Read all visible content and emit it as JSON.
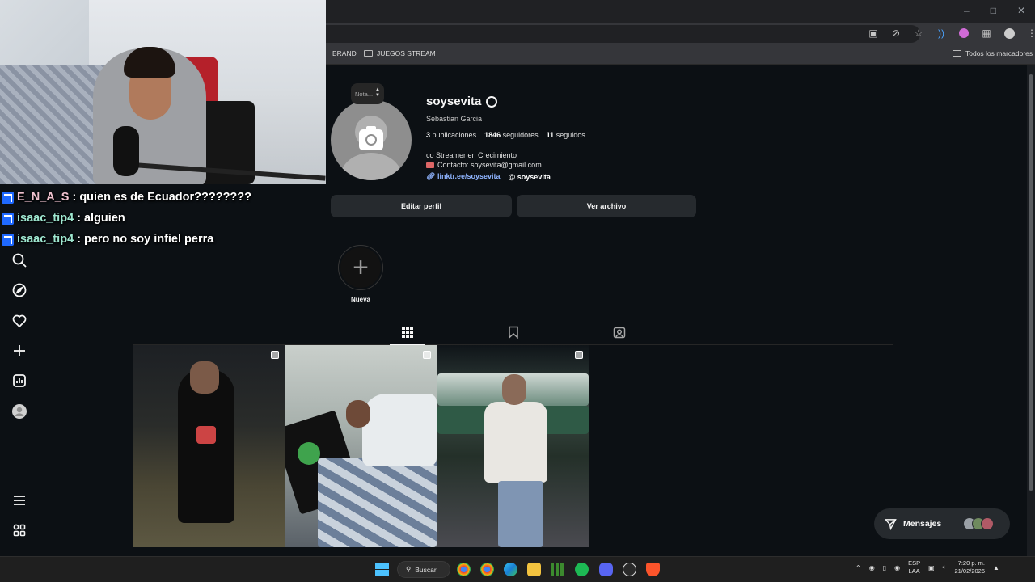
{
  "browser": {
    "bookmarks": [
      {
        "label": "BRAND"
      },
      {
        "label": "JUEGOS STREAM"
      }
    ],
    "all_bookmarks": "Todos los marcadores"
  },
  "chat": [
    {
      "user": "E_N_A_S",
      "sep": ":",
      "text": "quien es de Ecuador????????"
    },
    {
      "user": "isaac_tip4",
      "sep": ":",
      "text": "alguien"
    },
    {
      "user": "isaac_tip4",
      "sep": ":",
      "text": "pero no soy infiel perra"
    }
  ],
  "profile": {
    "note": "Nota...",
    "username": "soysevita",
    "full_name": "Sebastian Garcia",
    "posts_count": "3",
    "posts_label": "publicaciones",
    "followers_count": "1846",
    "followers_label": "seguidores",
    "following_count": "11",
    "following_label": "seguidos",
    "bio_line1": "co Streamer en Crecimiento",
    "bio_line2": "Contacto: soysevita@gmail.com",
    "link": "linktr.ee/soysevita",
    "threads": "soysevita",
    "edit_button": "Editar perfil",
    "archive_button": "Ver archivo",
    "new_highlight": "Nueva",
    "new_highlight_symbol": "+"
  },
  "messages": {
    "label": "Mensajes"
  },
  "taskbar": {
    "search": "Buscar",
    "lang_top": "ESP",
    "lang_bottom": "LAA",
    "time": "7:20 p. m.",
    "date": "21/02/2026",
    "apps": [
      "chrome",
      "chrome",
      "edge",
      "file-explorer",
      "minecraft",
      "spotify",
      "discord",
      "obs",
      "brave"
    ]
  },
  "colors": {
    "page_bg": "#0c1014",
    "button_bg": "#262a2e",
    "link": "#8fb4ff",
    "chat_badge": "#1f69ff"
  }
}
